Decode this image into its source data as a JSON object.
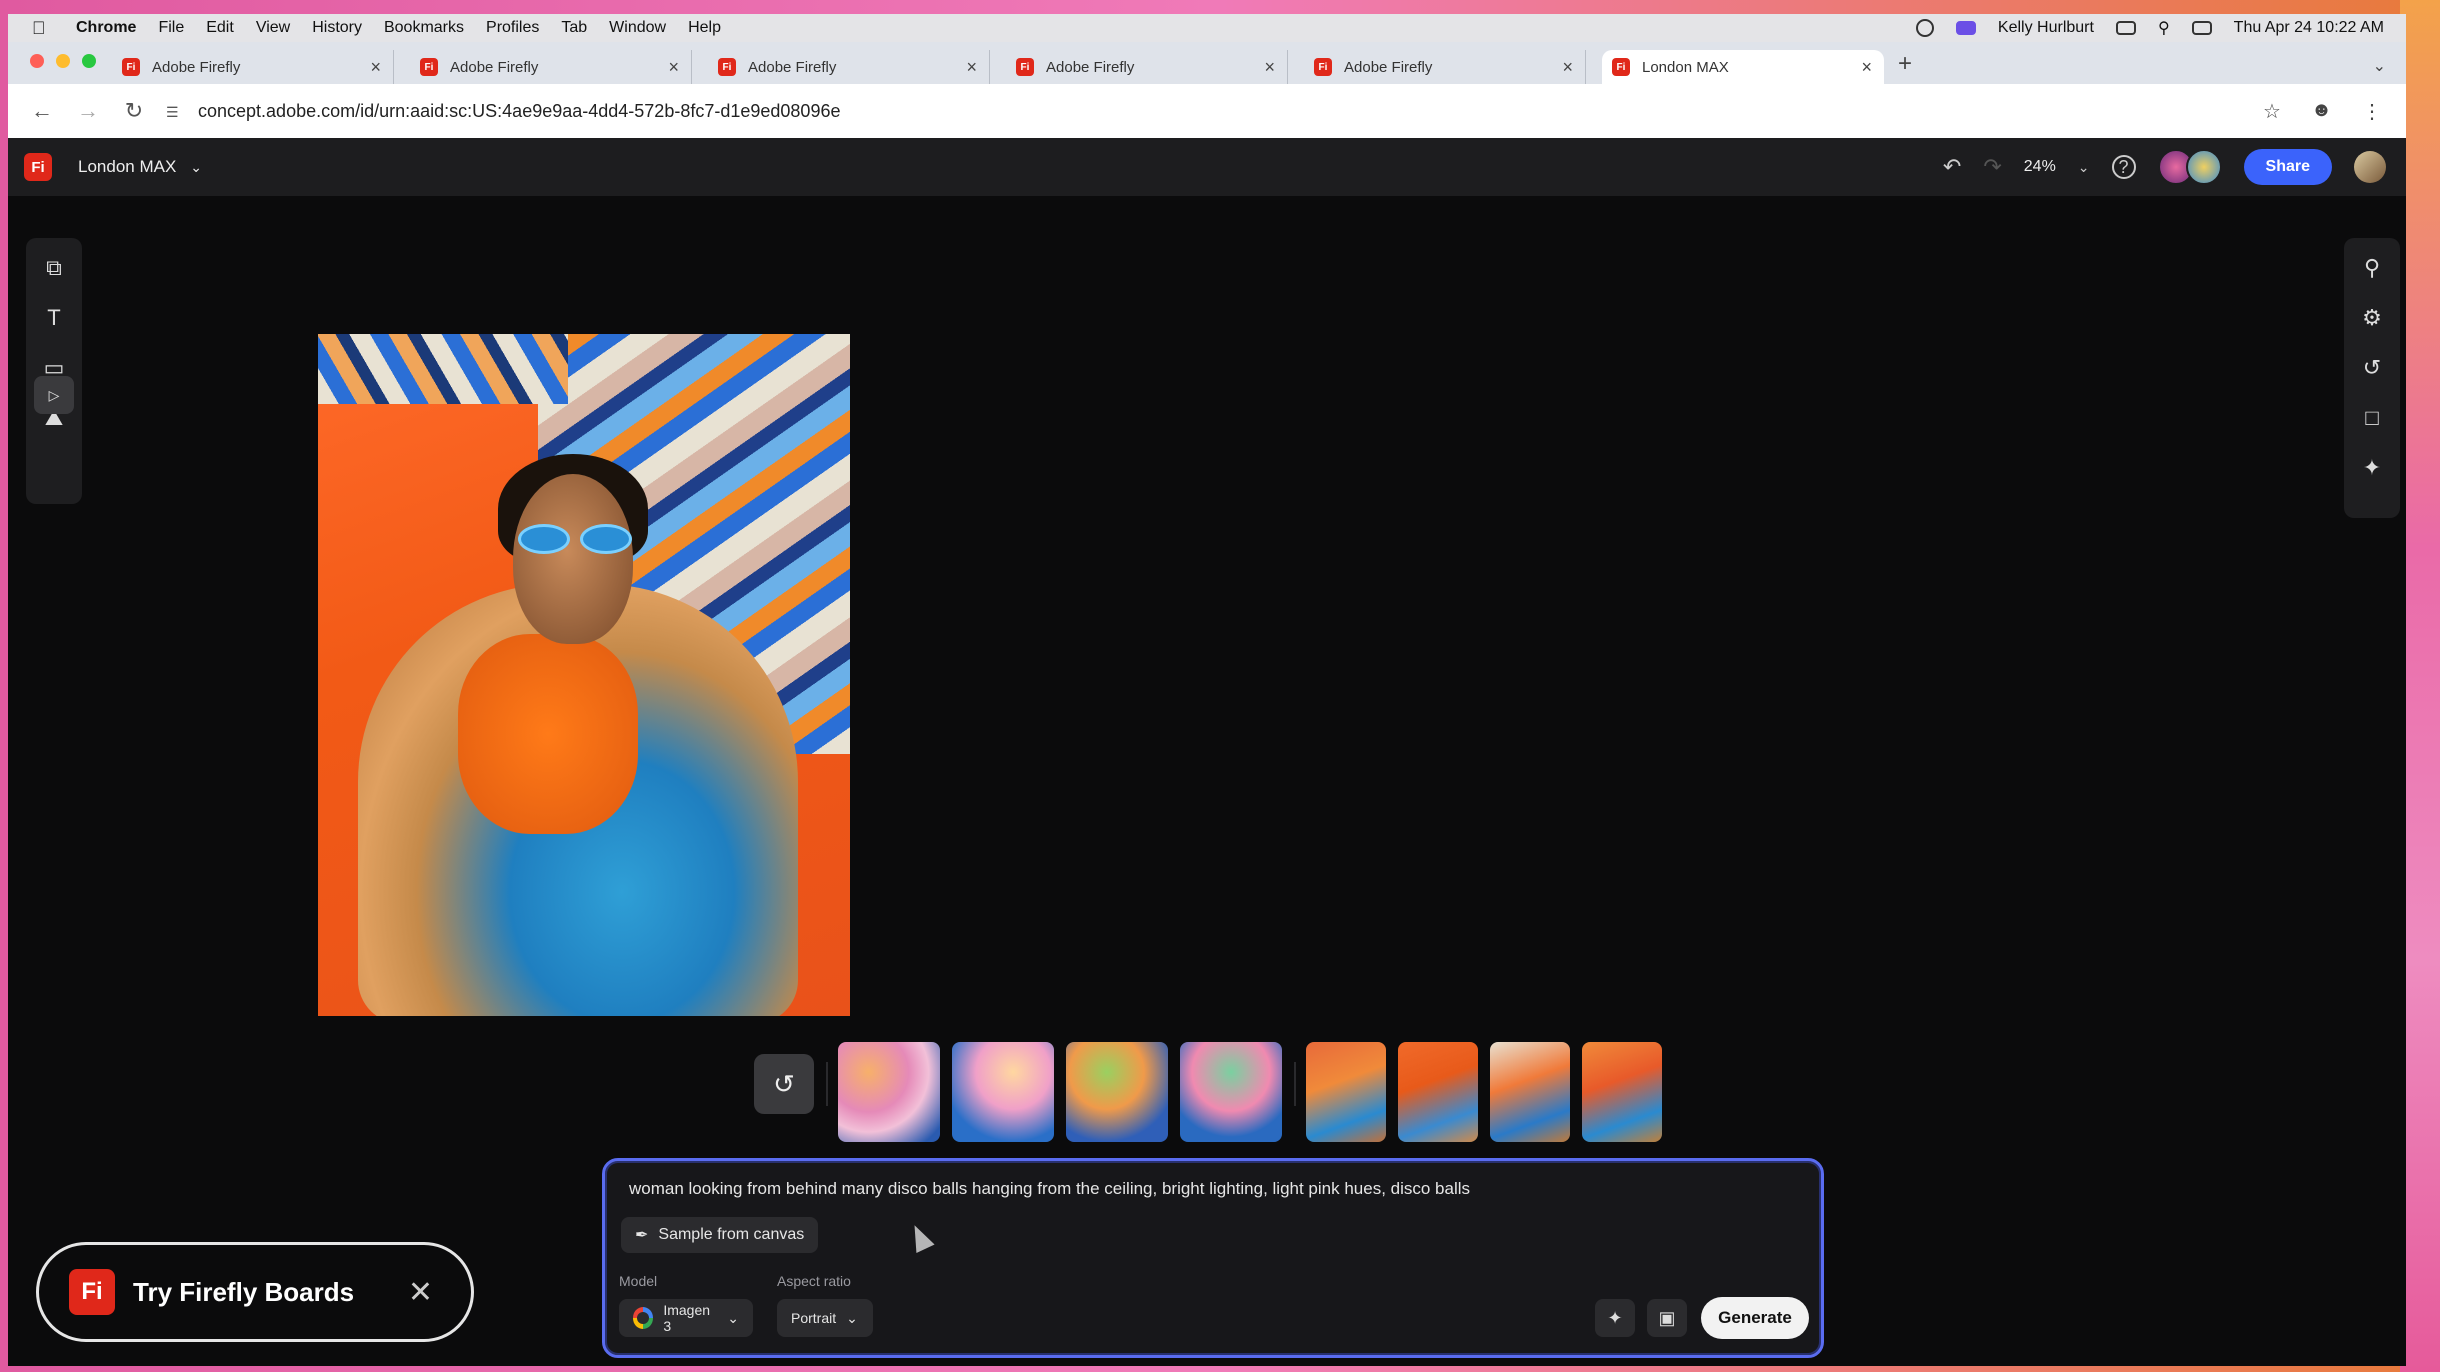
{
  "menubar": {
    "items": [
      "Chrome",
      "File",
      "Edit",
      "View",
      "History",
      "Bookmarks",
      "Profiles",
      "Tab",
      "Window",
      "Help"
    ],
    "user": "Kelly Hurlburt",
    "datetime": "Thu Apr 24  10:22 AM"
  },
  "tabs": [
    {
      "title": "Adobe Firefly"
    },
    {
      "title": "Adobe Firefly"
    },
    {
      "title": "Adobe Firefly"
    },
    {
      "title": "Adobe Firefly"
    },
    {
      "title": "Adobe Firefly"
    },
    {
      "title": "London MAX"
    }
  ],
  "address": {
    "url": "concept.adobe.com/id/urn:aaid:sc:US:4ae9e9aa-4dd4-572b-8fc7-d1e9ed08096e"
  },
  "app": {
    "logo": "Fi",
    "doc_name": "London MAX",
    "zoom": "24%",
    "share_label": "Share"
  },
  "prompt": {
    "text": "woman looking from behind many disco balls hanging from the ceiling, bright lighting, light pink hues, disco balls",
    "sample_label": "Sample from canvas",
    "model_label": "Model",
    "model_value": "Imagen 3",
    "aspect_label": "Aspect ratio",
    "aspect_value": "Portrait",
    "generate_label": "Generate"
  },
  "promo": {
    "logo": "Fi",
    "text": "Try Firefly Boards"
  },
  "colors": {
    "accent": "#3b63fb",
    "brand": "#e0281a",
    "prompt_border": "#5a6cf0"
  }
}
